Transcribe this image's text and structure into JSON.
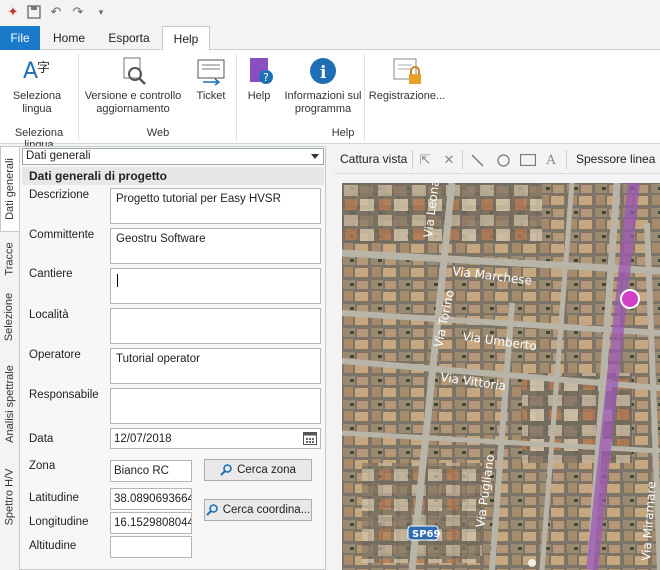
{
  "tabs": {
    "file": "File",
    "home": "Home",
    "export": "Esporta",
    "help": "Help"
  },
  "ribbon": {
    "language_button": "Seleziona lingua",
    "version_button": "Versione e controllo aggiornamento",
    "ticket_button": "Ticket",
    "help_button": "Help",
    "info_button": "Informazioni sul programma",
    "register_button": "Registrazione...",
    "groups": {
      "language": "Seleziona lingua",
      "web": "Web",
      "help": "Help"
    }
  },
  "side_tabs": [
    "Dati generali",
    "Tracce",
    "Selezione",
    "Analisi spettrale",
    "Spettro H/V"
  ],
  "panel": {
    "combo_value": "Dati generali",
    "section_title": "Dati generali di progetto",
    "fields": {
      "descrizione": {
        "label": "Descrizione",
        "value": "Progetto tutorial per Easy HVSR"
      },
      "committente": {
        "label": "Committente",
        "value": "Geostru Software"
      },
      "cantiere": {
        "label": "Cantiere",
        "value": ""
      },
      "localita": {
        "label": "Località",
        "value": ""
      },
      "operatore": {
        "label": "Operatore",
        "value": "Tutorial operator"
      },
      "responsabile": {
        "label": "Responsabile",
        "value": ""
      },
      "data": {
        "label": "Data",
        "value": "12/07/2018"
      },
      "zona": {
        "label": "Zona",
        "value": "Bianco RC"
      },
      "latitudine": {
        "label": "Latitudine",
        "value": "38.0890693664"
      },
      "longitudine": {
        "label": "Longitudine",
        "value": "16.1529808044"
      },
      "altitudine": {
        "label": "Altitudine",
        "value": ""
      }
    },
    "search_zone_button": "Cerca zona",
    "search_coord_button": "Cerca coordina..."
  },
  "map_toolbar": {
    "capture": "Cattura vista",
    "stroke": "Spessore linea"
  },
  "map": {
    "roads": [
      "Via Leonardo",
      "Via Marchese",
      "Via Torino",
      "Via Umberto",
      "Via Vittoria",
      "Via Pugliano",
      "Via Miramare"
    ],
    "badge": "SP69",
    "marker_color": "#d23fc8"
  }
}
